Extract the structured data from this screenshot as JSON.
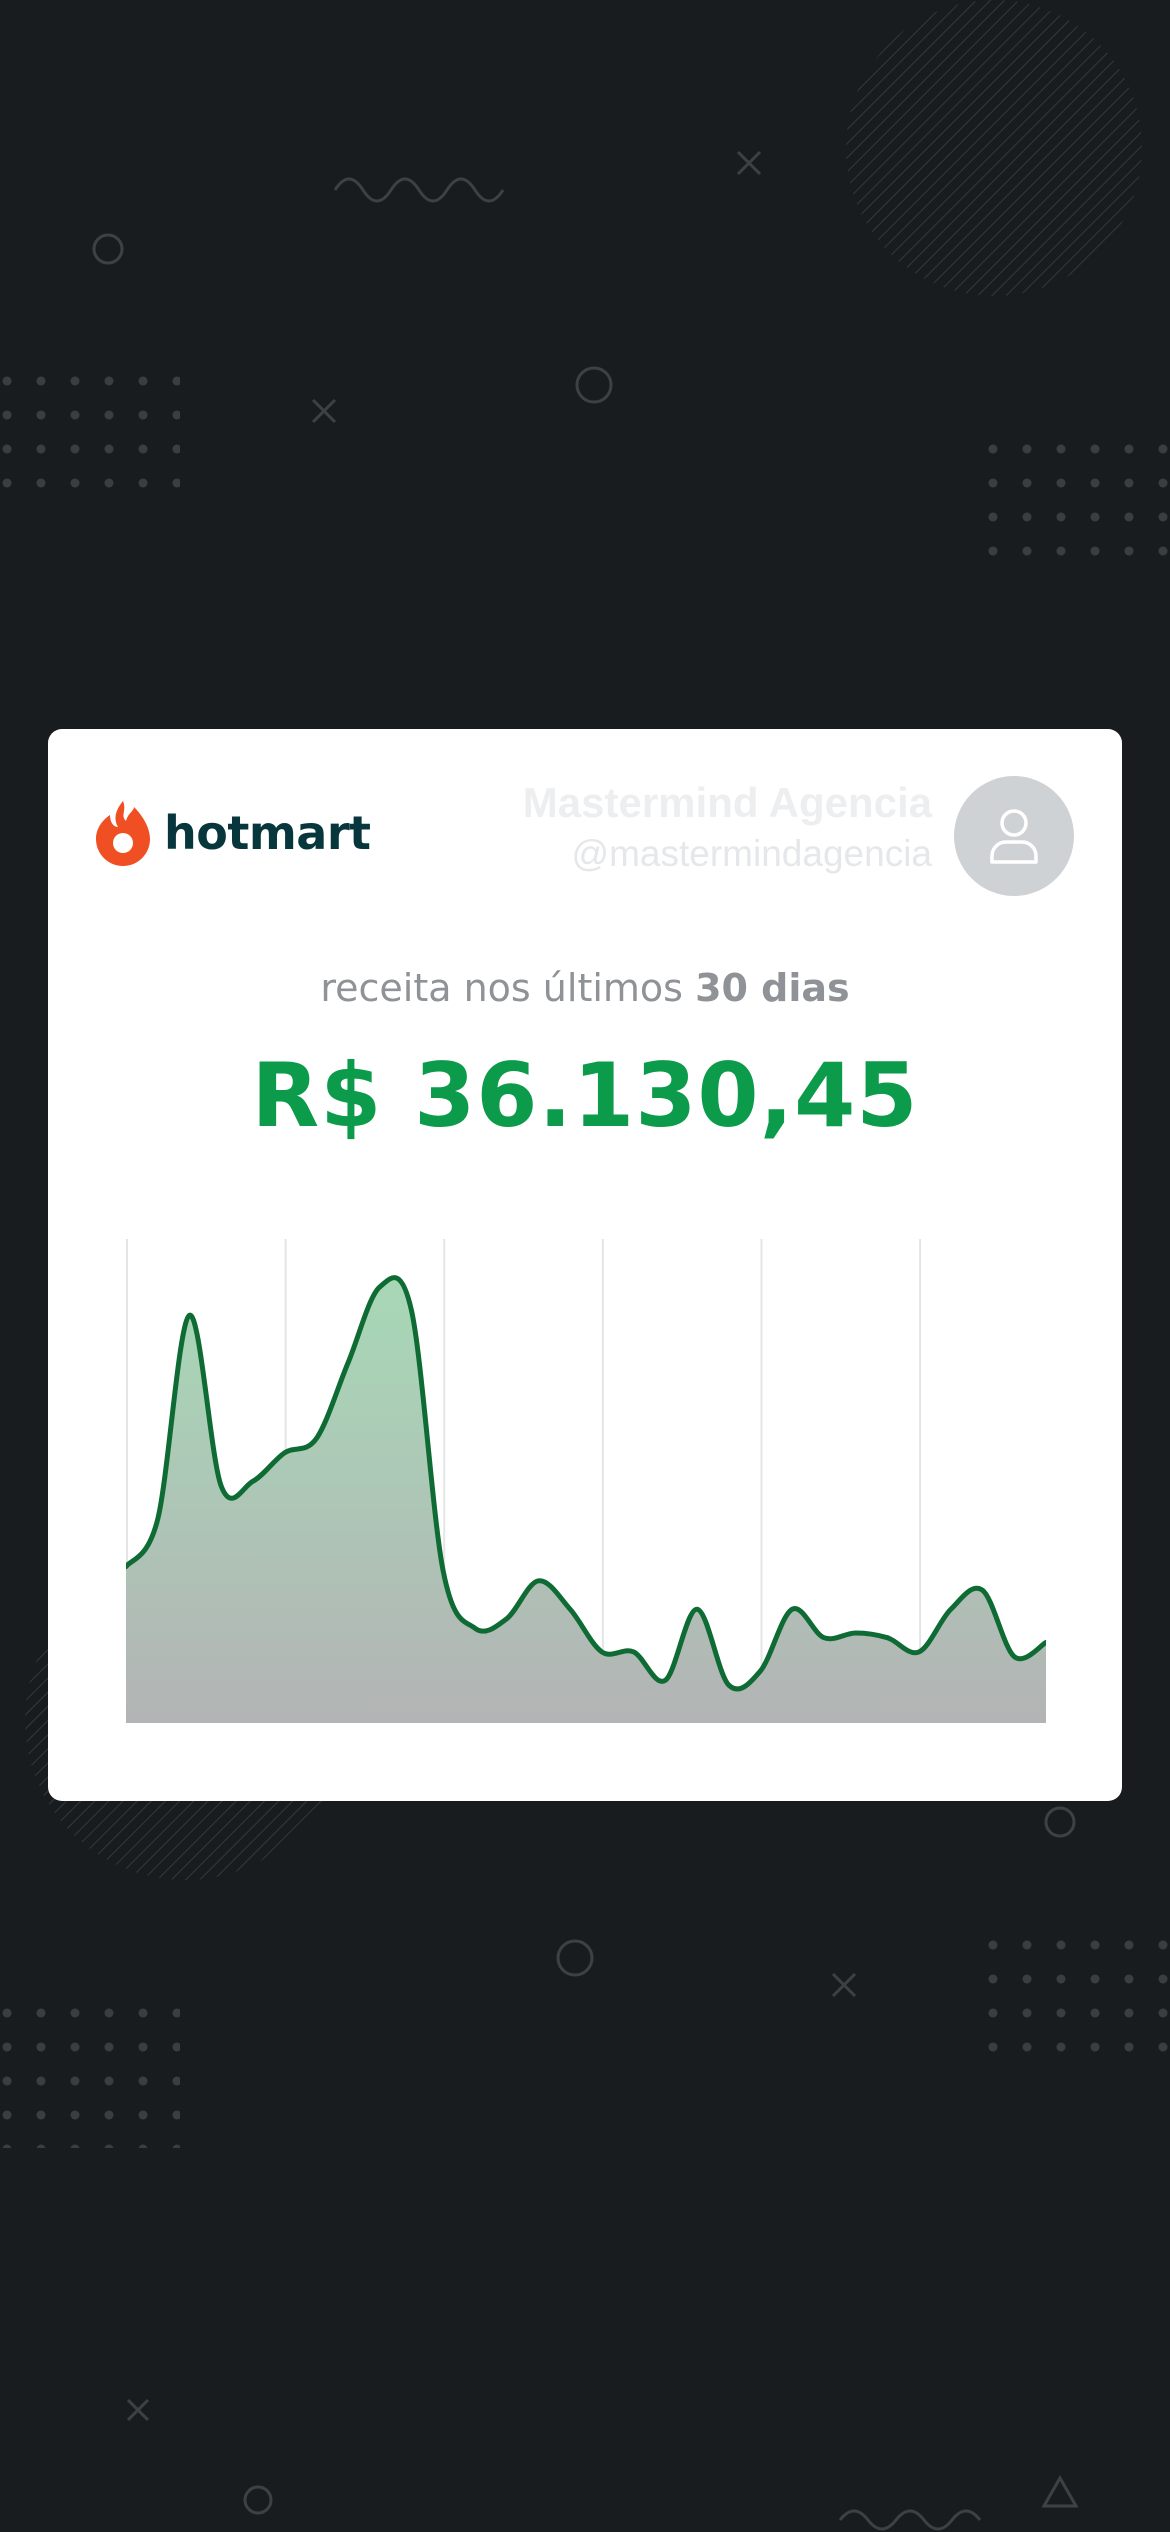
{
  "brand": {
    "name": "hotmart"
  },
  "profile": {
    "name": "Mastermind Agencia",
    "handle": "@mastermindagencia"
  },
  "revenue": {
    "label_prefix": "receita nos últimos",
    "label_period": "30 dias",
    "amount": "R$ 36.130,45"
  },
  "colors": {
    "background": "#191c1f",
    "card": "#ffffff",
    "amount": "#0b9b4a",
    "line": "#0f6b34",
    "brand_text": "#07363d",
    "flame": "#f04e23"
  },
  "chart_data": {
    "type": "area",
    "x": [
      0,
      1,
      2,
      3,
      4,
      5,
      6,
      7,
      8,
      9,
      10,
      11,
      12,
      13,
      14,
      15,
      16,
      17,
      18,
      19,
      20,
      21,
      22,
      23,
      24,
      25,
      26,
      27,
      28,
      29
    ],
    "y": [
      33,
      43,
      86,
      50,
      51,
      57,
      60,
      76,
      92,
      87,
      32,
      20,
      22,
      30,
      24,
      15,
      15,
      9,
      24,
      8,
      11,
      24,
      18,
      19,
      18,
      15,
      24,
      28,
      14,
      17
    ],
    "ylim": [
      0,
      100
    ],
    "grid": "vertical",
    "title": "",
    "xlabel": "",
    "ylabel": ""
  }
}
